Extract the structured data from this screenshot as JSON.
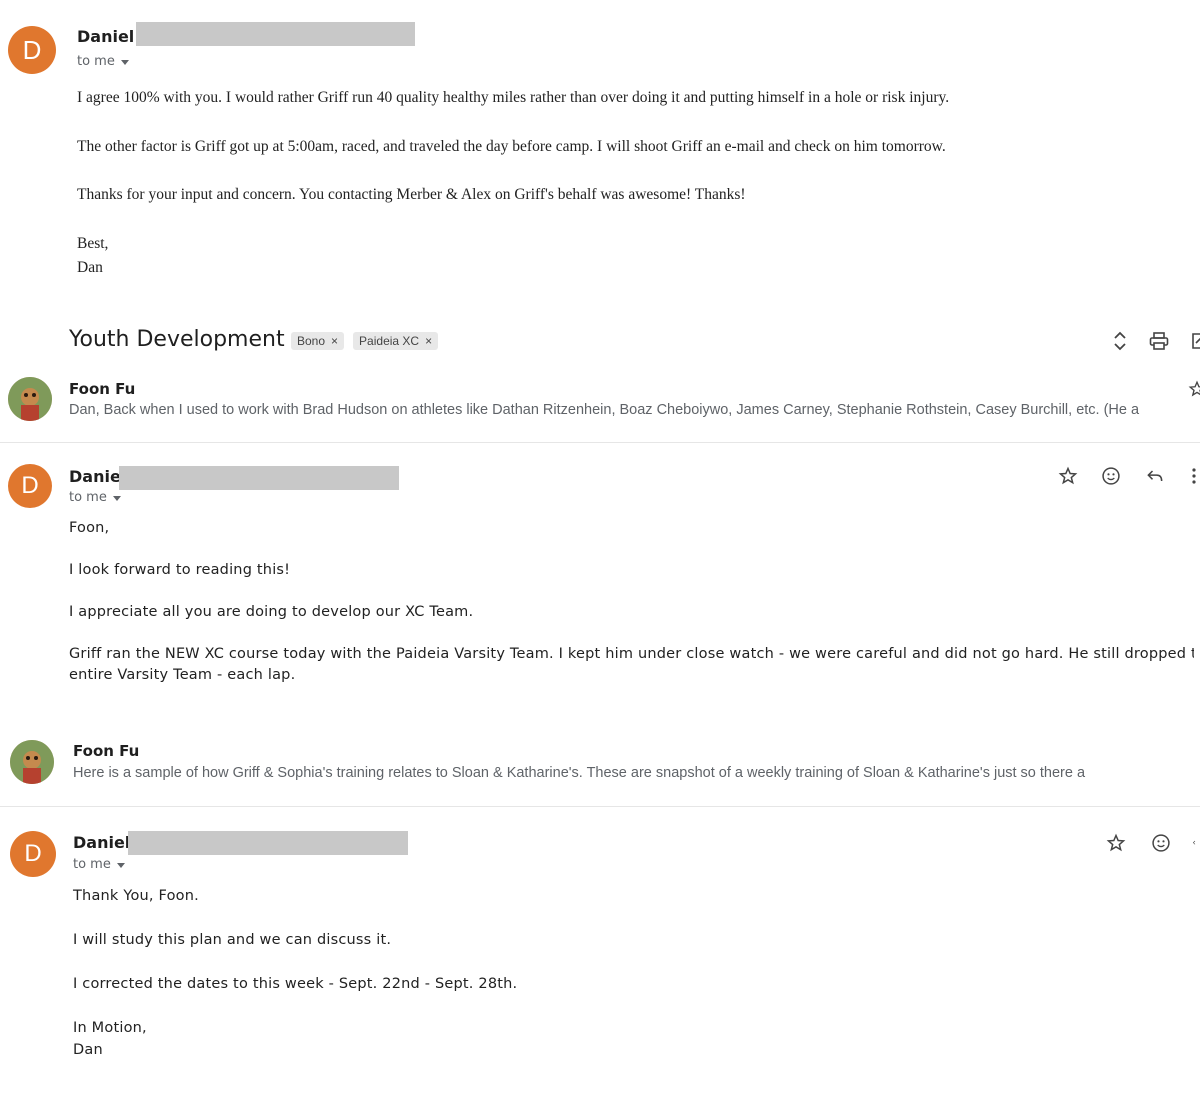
{
  "message1": {
    "avatar_letter": "D",
    "sender": "Daniel",
    "recipient": "to me",
    "paragraphs": [
      "I agree 100% with you.  I would rather Griff run 40 quality healthy miles rather than over doing it and putting himself in a hole or risk injury.",
      "The other factor is Griff got up at 5:00am, raced, and traveled the day before camp.  I will shoot Griff an e-mail and check on him tomorrow.",
      "Thanks for your input and concern.  You contacting Merber & Alex on Griff's behalf was awesome! Thanks!"
    ],
    "closing": "Best,",
    "signature": "Dan"
  },
  "thread": {
    "subject": "Youth Development",
    "labels": [
      "Bono",
      "Paideia XC"
    ],
    "icons": [
      "expand-collapse-icon",
      "print-icon",
      "open-new-window-icon"
    ]
  },
  "collapsed1": {
    "sender": "Foon Fu",
    "snippet": "Dan, Back when I used to work with Brad Hudson on athletes like Dathan Ritzenhein, Boaz Cheboiywo, James Carney, Stephanie Rothstein, Casey Burchill, etc. (He a"
  },
  "message2": {
    "avatar_letter": "D",
    "sender": "Daniel",
    "recipient": "to me",
    "greeting": "Foon,",
    "line1": "I look forward to reading this!",
    "line2": "I appreciate all you are doing to develop our XC Team.",
    "line3a": "Griff ran the NEW XC course today with the Paideia Varsity Team.  I kept him under close watch - we were careful and did not go hard.  He still dropped the",
    "line3b": "entire Varsity Team - each lap."
  },
  "collapsed2": {
    "sender": "Foon Fu",
    "snippet": "Here is a sample of how Griff & Sophia's training relates to Sloan & Katharine's. These are snapshot of a weekly training of Sloan & Katharine's just so there a"
  },
  "message3": {
    "avatar_letter": "D",
    "sender": "Daniel",
    "recipient": "to me",
    "line1": "Thank You, Foon.",
    "line2": "I will study this plan and we can discuss it.",
    "line3": "I corrected the dates to this week - Sept. 22nd - Sept. 28th.",
    "closing": "In Motion,",
    "signature": "Dan"
  },
  "colors": {
    "avatar": "#e0772e",
    "redaction": "#c8c8c8",
    "muted_text": "#5f6368"
  }
}
